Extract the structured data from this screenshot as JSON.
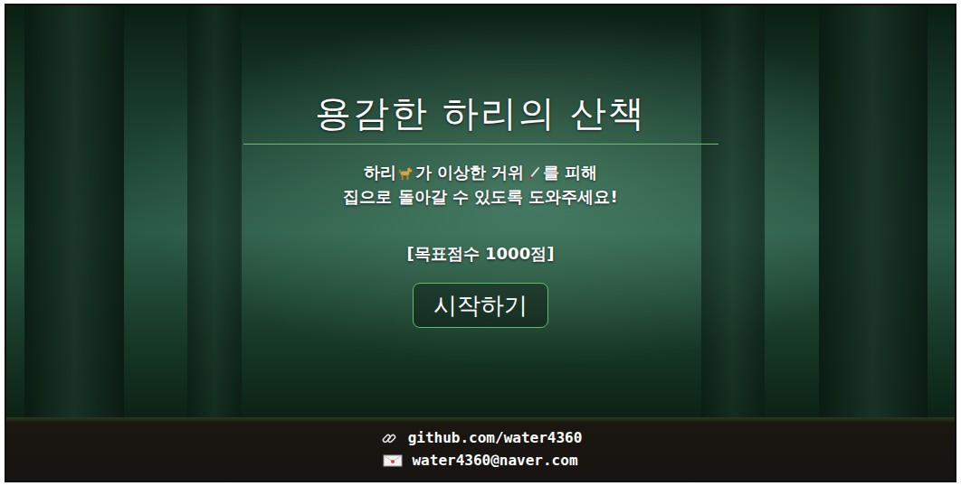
{
  "title": "용감한 하리의 산책",
  "intro": {
    "line1": {
      "name": "하리",
      "after_name": "가 이상한 거위",
      "after_item": "를 피해"
    },
    "line2": "집으로 돌아갈 수 있도록 도와주세요!"
  },
  "goal": "[목표점수 1000점]",
  "start_button": "시작하기",
  "footer": {
    "github": "github.com/water4360",
    "email": "water4360@naver.com"
  }
}
